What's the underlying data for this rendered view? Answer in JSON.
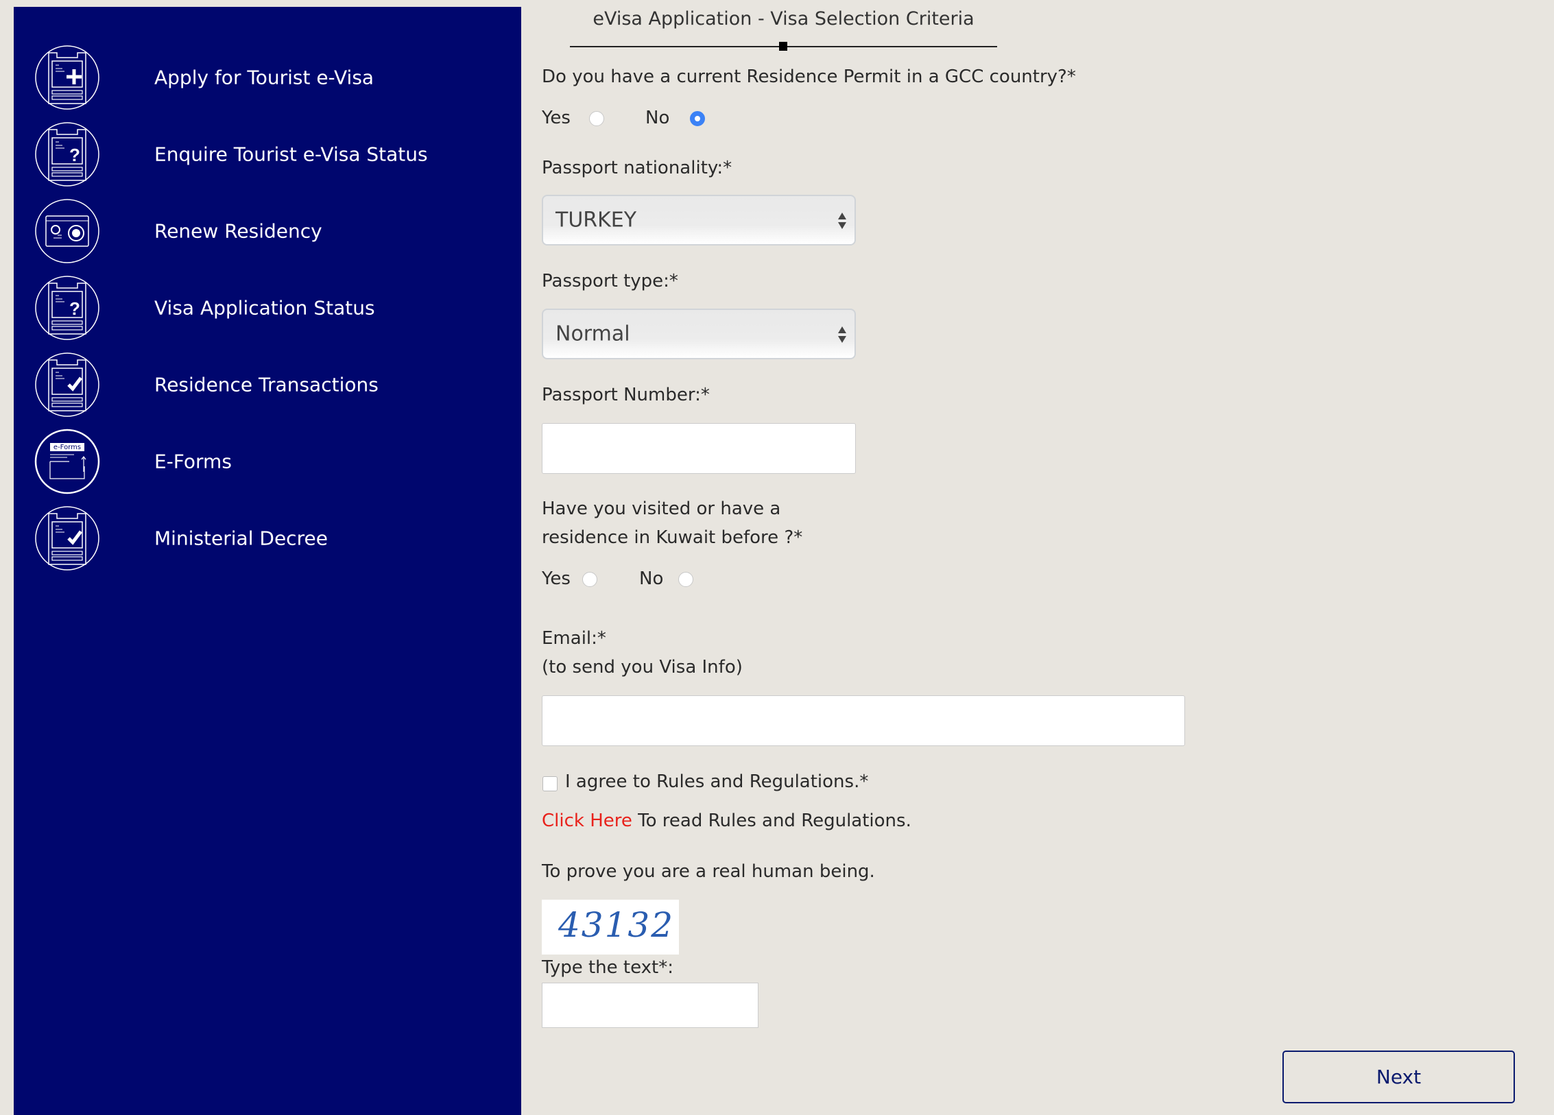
{
  "sidebar": {
    "items": [
      {
        "label": "Apply for Tourist e-Visa",
        "icon": "clipboard-plus-icon"
      },
      {
        "label": "Enquire Tourist e-Visa Status",
        "icon": "clipboard-question-icon"
      },
      {
        "label": "Renew Residency",
        "icon": "residency-card-icon"
      },
      {
        "label": "Visa Application Status",
        "icon": "clipboard-question-icon"
      },
      {
        "label": "Residence Transactions",
        "icon": "clipboard-check-icon"
      },
      {
        "label": "E-Forms",
        "icon": "eforms-icon",
        "icon_text": "e-Forms"
      },
      {
        "label": "Ministerial Decree",
        "icon": "clipboard-check-icon"
      }
    ]
  },
  "form": {
    "title": "eVisa Application - Visa Selection Criteria",
    "gcc_question": "Do you have a current Residence Permit in a GCC country?*",
    "gcc_yes": "Yes",
    "gcc_no": "No",
    "gcc_selected": "No",
    "nationality_label": "Passport nationality:*",
    "nationality_value": "TURKEY",
    "passport_type_label": "Passport type:*",
    "passport_type_value": "Normal",
    "passport_number_label": "Passport Number:*",
    "passport_number_value": "",
    "visited_question_line1": "Have you visited or have a",
    "visited_question_line2": "residence in Kuwait before ?*",
    "visited_yes": "Yes",
    "visited_no": "No",
    "email_label": "Email:*",
    "email_sublabel": "(to send you Visa Info)",
    "email_value": "",
    "agree_label": "I agree to Rules and Regulations.*",
    "agree_checked": false,
    "click_here": "Click Here",
    "rules_text": " To read Rules and Regulations.",
    "human_text": "To prove you are a real human being.",
    "captcha_text": "43132",
    "captcha_label": "Type the text*:",
    "captcha_value": "",
    "next_label": "Next"
  },
  "colors": {
    "sidebar": "#00066e",
    "background": "#e8e5df",
    "link": "#e8211b",
    "radio_selected": "#3b82f6"
  }
}
